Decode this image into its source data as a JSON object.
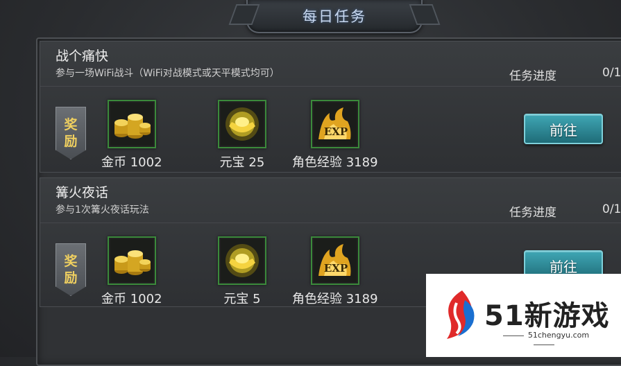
{
  "header": {
    "title": "每日任务"
  },
  "tasks": [
    {
      "name": "战个痛快",
      "desc": "参与一场WiFi战斗（WiFi对战模式或天平模式均可）",
      "progress_label": "任务进度",
      "progress_value": "0/1",
      "reward_badge": [
        "奖",
        "励"
      ],
      "rewards": [
        {
          "icon": "gold-coins-icon",
          "label": "金币 1002"
        },
        {
          "icon": "gold-ingot-icon",
          "label": "元宝 25"
        },
        {
          "icon": "exp-icon",
          "label": "角色经验 3189"
        }
      ],
      "button": "前往"
    },
    {
      "name": "篝火夜话",
      "desc": "参与1次篝火夜话玩法",
      "progress_label": "任务进度",
      "progress_value": "0/1",
      "reward_badge": [
        "奖",
        "励"
      ],
      "rewards": [
        {
          "icon": "gold-coins-icon",
          "label": "金币 1002"
        },
        {
          "icon": "gold-ingot-icon",
          "label": "元宝 5"
        },
        {
          "icon": "exp-icon",
          "label": "角色经验 3189"
        }
      ],
      "button": "前往"
    }
  ],
  "watermark": {
    "brand": "51新游戏",
    "url": "51chengyu.com"
  },
  "colors": {
    "accent_button": "#2a8a98",
    "icon_border": "#3b8a3b",
    "reward_text": "#f0d060"
  }
}
